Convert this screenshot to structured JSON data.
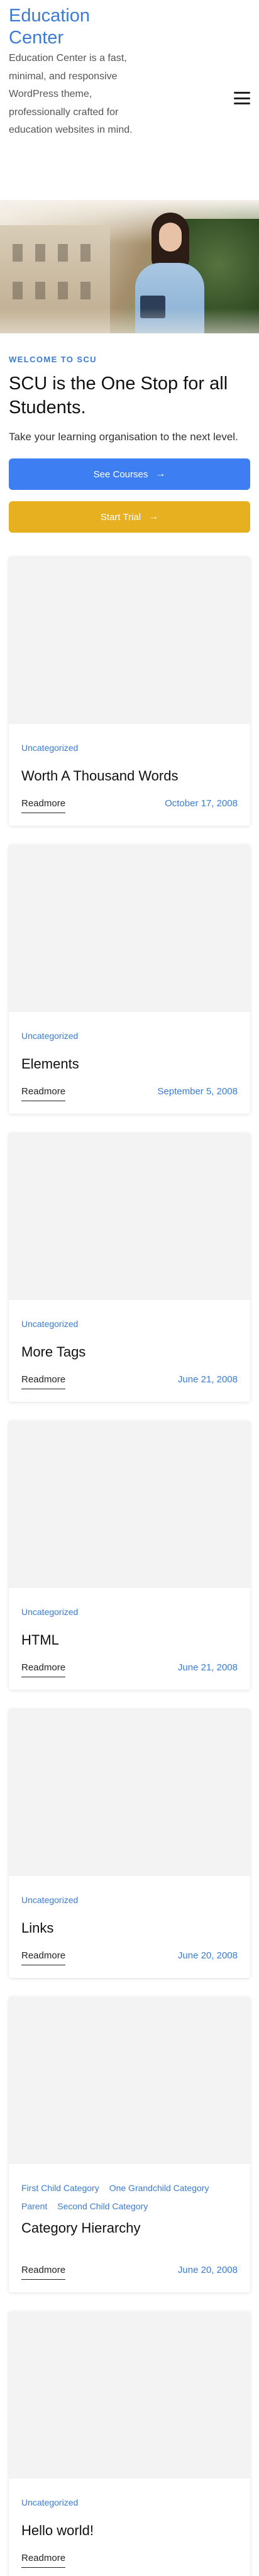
{
  "header": {
    "site_title": "Education Center",
    "site_description": "Education Center is a fast, minimal, and responsive WordPress theme, professionally crafted for education websites in mind."
  },
  "hero": {
    "kicker": "WELCOME TO SCU",
    "heading": "SCU is the One Stop for all Students.",
    "subheading": "Take your learning organisation to the next level.",
    "primary_button": "See Courses",
    "secondary_button": "Start Trial",
    "primary_color": "#3d7ff2",
    "secondary_color": "#e7b020"
  },
  "posts": [
    {
      "categories": [
        "Uncategorized"
      ],
      "title": "Worth A Thousand Words",
      "readmore": "Readmore",
      "date": "October 17, 2008"
    },
    {
      "categories": [
        "Uncategorized"
      ],
      "title": "Elements",
      "readmore": "Readmore",
      "date": "September 5, 2008"
    },
    {
      "categories": [
        "Uncategorized"
      ],
      "title": "More Tags",
      "readmore": "Readmore",
      "date": "June 21, 2008"
    },
    {
      "categories": [
        "Uncategorized"
      ],
      "title": "HTML",
      "readmore": "Readmore",
      "date": "June 21, 2008"
    },
    {
      "categories": [
        "Uncategorized"
      ],
      "title": "Links",
      "readmore": "Readmore",
      "date": "June 20, 2008"
    },
    {
      "categories": [
        "First Child Category",
        "One Grandchild Category",
        "Parent",
        "Second Child Category"
      ],
      "title": "Category Hierarchy",
      "readmore": "Readmore",
      "date": "June 20, 2008"
    },
    {
      "categories": [
        "Uncategorized"
      ],
      "title": "Hello world!",
      "readmore": "Readmore",
      "date": ""
    }
  ],
  "accent_color": "#3a7bd5",
  "icons": {
    "menu": "hamburger-icon",
    "arrow": "arrow-right-icon"
  }
}
